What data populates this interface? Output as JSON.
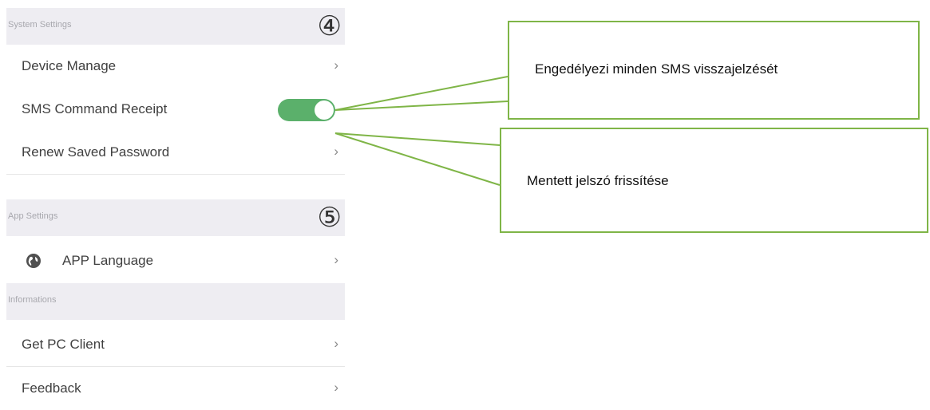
{
  "system_settings": {
    "header": "System Settings",
    "step": "④",
    "device_manage": {
      "label": "Device Manage",
      "chevron": "›"
    },
    "sms_receipt": {
      "label": "SMS Command Receipt",
      "toggle_on": true,
      "toggle_color": "#5bb06b"
    },
    "renew_password": {
      "label": "Renew Saved Password",
      "chevron": "›"
    }
  },
  "app_settings": {
    "header": "App Settings",
    "step": "⑤",
    "language": {
      "label": "APP Language",
      "icon": "globe-icon",
      "chevron": "›"
    }
  },
  "informations": {
    "header": "Informations",
    "pc_client": {
      "label": "Get PC Client",
      "chevron": "›"
    },
    "feedback": {
      "label": "Feedback",
      "chevron": "›"
    }
  },
  "callouts": {
    "sms": "Engedélyezi minden SMS visszajelzését",
    "password": "Mentett jelszó frissítése",
    "border_color": "#7fb547"
  }
}
